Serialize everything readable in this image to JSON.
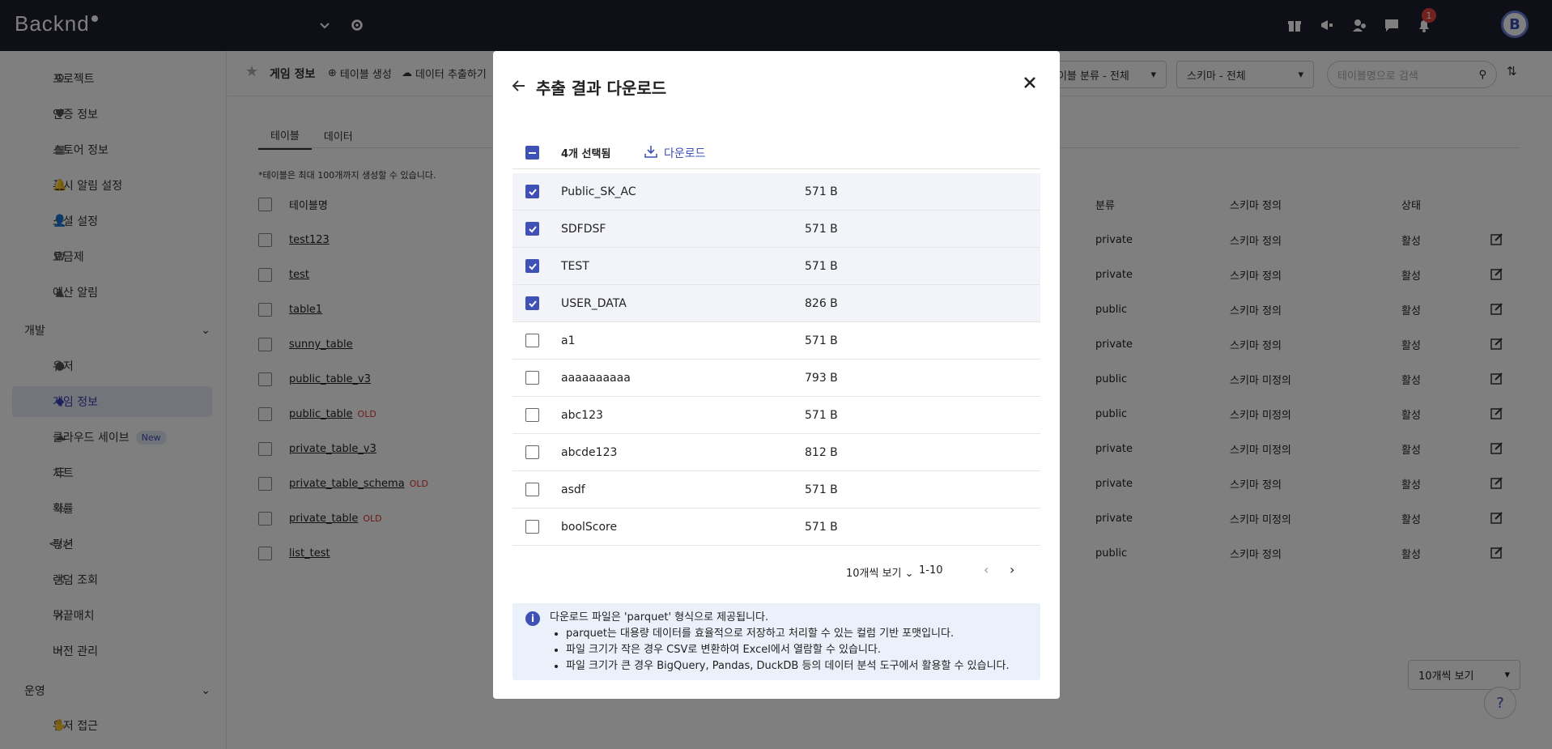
{
  "app": {
    "brand": "Backnd"
  },
  "topbar": {
    "notification_count": "1",
    "avatar_letter": "B"
  },
  "sidebar": {
    "items": [
      {
        "label": "프로젝트",
        "icon": "gear-icon"
      },
      {
        "label": "인증 정보",
        "icon": "shield-check-icon"
      },
      {
        "label": "스토어 정보",
        "icon": "store-icon"
      },
      {
        "label": "푸시 알림 설정",
        "icon": "bell-settings-icon"
      },
      {
        "label": "소셜 설정",
        "icon": "user-settings-icon"
      },
      {
        "label": "요금제",
        "icon": "won-icon"
      },
      {
        "label": "예산 알림",
        "icon": "warning-icon"
      }
    ],
    "section_dev": "개발",
    "dev_items": [
      {
        "label": "유저",
        "icon": "person-icon"
      },
      {
        "label": "게임 정보",
        "icon": "gamepad-icon"
      },
      {
        "label": "클라우드 세이브",
        "icon": "cloud-icon",
        "badge": "New"
      },
      {
        "label": "차트",
        "icon": "list-icon"
      },
      {
        "label": "확률",
        "icon": "percent-icon"
      },
      {
        "label": "펑션",
        "icon": "code-icon"
      },
      {
        "label": "랜덤 조회",
        "icon": "shuffle-icon"
      },
      {
        "label": "뒤끝매치",
        "icon": "swords-icon"
      },
      {
        "label": "버전 관리",
        "icon": "branch-icon"
      }
    ],
    "section_ops": "운영",
    "ops_items": [
      {
        "label": "유저 접근",
        "icon": "hand-icon"
      }
    ]
  },
  "header": {
    "title": "게임 정보",
    "create_table": "테이블 생성",
    "extract_data": "데이터 추출하기",
    "filter_category": "테이블 분류 - 전체",
    "filter_schema": "스키마 - 전체",
    "search_placeholder": "테이블명으로 검색"
  },
  "tabs": [
    "테이블",
    "데이터"
  ],
  "note": "*테이블은 최대 100개까지 생성할 수 있습니다.",
  "table": {
    "headers": {
      "name": "테이블명",
      "category": "분류",
      "schema": "스키마 정의",
      "state": "상태"
    },
    "rows": [
      {
        "name": "test123",
        "old": "",
        "category": "private",
        "schema": "스키마 정의",
        "state": "활성"
      },
      {
        "name": "test",
        "old": "",
        "category": "private",
        "schema": "스키마 정의",
        "state": "활성"
      },
      {
        "name": "table1",
        "old": "",
        "category": "public",
        "schema": "스키마 정의",
        "state": "활성"
      },
      {
        "name": "sunny_table",
        "old": "",
        "category": "private",
        "schema": "스키마 정의",
        "state": "활성"
      },
      {
        "name": "public_table_v3",
        "old": "",
        "category": "public",
        "schema": "스키마 미정의",
        "state": "활성"
      },
      {
        "name": "public_table",
        "old": "OLD",
        "category": "public",
        "schema": "스키마 미정의",
        "state": "활성"
      },
      {
        "name": "private_table_v3",
        "old": "",
        "category": "private",
        "schema": "스키마 미정의",
        "state": "활성"
      },
      {
        "name": "private_table_schema",
        "old": "OLD",
        "category": "private",
        "schema": "스키마 정의",
        "state": "활성"
      },
      {
        "name": "private_table",
        "old": "OLD",
        "category": "private",
        "schema": "스키마 미정의",
        "state": "활성"
      },
      {
        "name": "list_test",
        "old": "",
        "category": "public",
        "schema": "스키마 정의",
        "state": "활성"
      }
    ],
    "page_size": "10개씩 보기"
  },
  "modal": {
    "title": "추출 결과 다운로드",
    "selected_count": "4개 선택됨",
    "download_label": "다운로드",
    "files": [
      {
        "name": "Public_SK_AC",
        "size": "571 B",
        "checked": true
      },
      {
        "name": "SDFDSF",
        "size": "571 B",
        "checked": true
      },
      {
        "name": "TEST",
        "size": "571 B",
        "checked": true
      },
      {
        "name": "USER_DATA",
        "size": "826 B",
        "checked": true
      },
      {
        "name": "a1",
        "size": "571 B",
        "checked": false
      },
      {
        "name": "aaaaaaaaaa",
        "size": "793 B",
        "checked": false
      },
      {
        "name": "abc123",
        "size": "571 B",
        "checked": false
      },
      {
        "name": "abcde123",
        "size": "812 B",
        "checked": false
      },
      {
        "name": "asdf",
        "size": "571 B",
        "checked": false
      },
      {
        "name": "boolScore",
        "size": "571 B",
        "checked": false
      }
    ],
    "page_size": "10개씩 보기",
    "page_range": "1-10",
    "info_title": "다운로드 파일은 'parquet' 형식으로 제공됩니다.",
    "info_items": [
      "parquet는 대용량 데이터를 효율적으로 저장하고 처리할 수 있는 컬럼 기반 포맷입니다.",
      "파일 크기가 작은 경우 CSV로 변환하여 Excel에서 열람할 수 있습니다.",
      "파일 크기가 큰 경우 BigQuery, Pandas, DuckDB 등의 데이터 분석 도구에서 활용할 수 있습니다."
    ]
  },
  "colors": {
    "topbar": "#1d1f2e",
    "accent": "#3f51b5",
    "old_badge": "#dd3333",
    "notification": "#e5453c"
  }
}
